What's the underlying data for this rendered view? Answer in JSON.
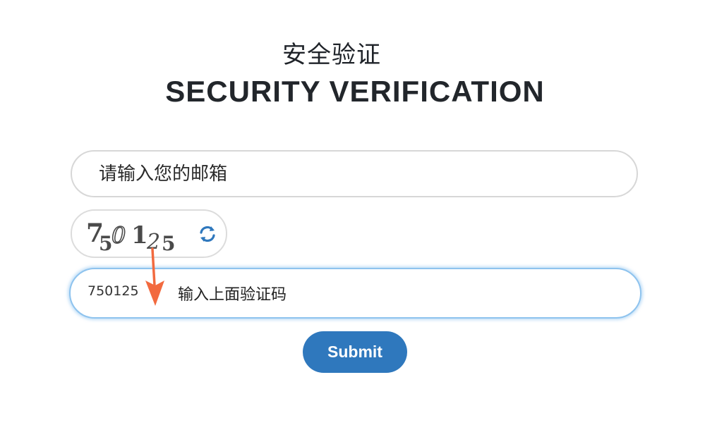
{
  "title": {
    "chinese": "安全验证",
    "english": "SECURITY VERIFICATION"
  },
  "email_field": {
    "placeholder": "请输入您的邮箱"
  },
  "captcha": {
    "code": "750125",
    "refresh_icon": "refresh-icon"
  },
  "code_field": {
    "value": "750125",
    "label": "输入上面验证码"
  },
  "submit": {
    "label": "Submit"
  },
  "colors": {
    "accent": "#2f78bd",
    "focus_border": "#8ec3ee",
    "annotation_arrow": "#f26a3f"
  }
}
